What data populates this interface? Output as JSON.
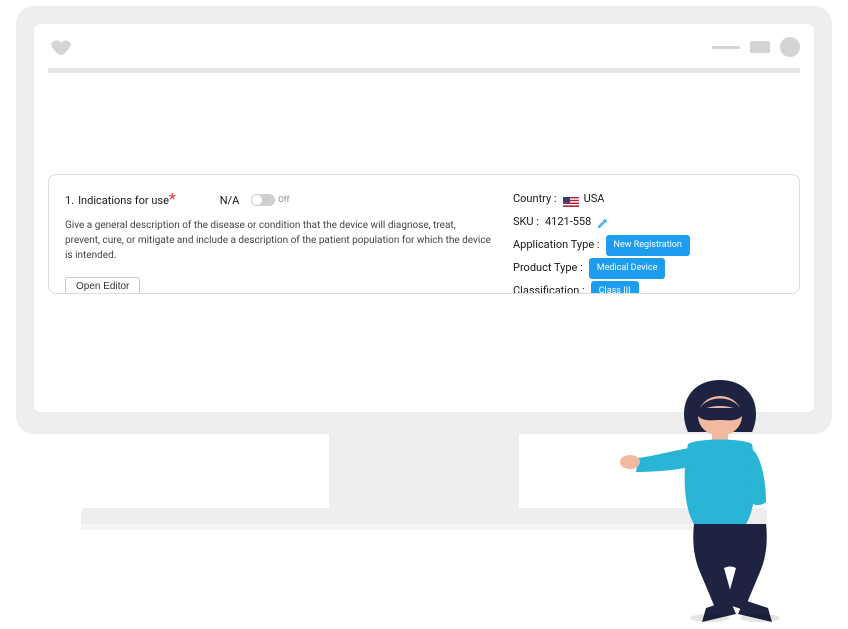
{
  "card": {
    "section_number": "1.",
    "section_title": "Indications for use",
    "na_label": "N/A",
    "toggle_state": "Off",
    "description": "Give a general description of the disease or condition that the device will diagnose, treat, prevent, cure, or mitigate and include a description of the patient population for which the device is intended.",
    "open_editor": "Open Editor"
  },
  "meta": {
    "country_label": "Country :",
    "country_value": "USA",
    "sku_label": "SKU :",
    "sku_value": "4121-558",
    "app_type_label": "Application Type :",
    "app_type_value": "New Registration",
    "prod_type_label": "Product Type :",
    "prod_type_value": "Medical Device",
    "class_label": "Classification :",
    "class_value": "Class III"
  }
}
